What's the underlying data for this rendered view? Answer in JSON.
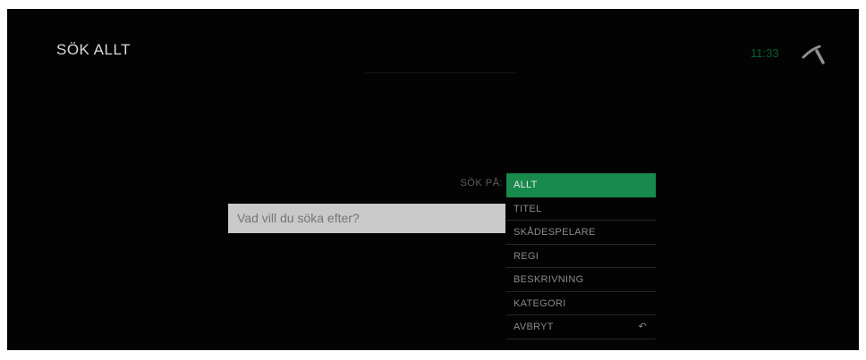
{
  "header": {
    "title": "SÖK ALLT",
    "clock": "11:33",
    "logo_icon": "telia-logo-icon"
  },
  "search": {
    "label": "SÖK PÅ:",
    "placeholder": "Vad vill du söka efter?",
    "value": ""
  },
  "menu": {
    "items": [
      {
        "label": "ALLT",
        "selected": true
      },
      {
        "label": "TITEL",
        "selected": false
      },
      {
        "label": "SKÅDESPELARE",
        "selected": false
      },
      {
        "label": "REGI",
        "selected": false
      },
      {
        "label": "BESKRIVNING",
        "selected": false
      },
      {
        "label": "KATEGORI",
        "selected": false
      },
      {
        "label": "AVBRYT",
        "selected": false,
        "icon": "return-icon"
      }
    ]
  },
  "colors": {
    "background": "#030303",
    "accent": "#188a4c",
    "input_background": "#c9c9c9"
  }
}
